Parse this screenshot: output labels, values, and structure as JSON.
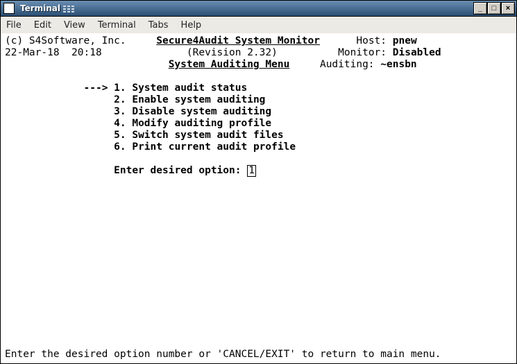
{
  "window": {
    "title": "Terminal"
  },
  "menubar": {
    "items": [
      "File",
      "Edit",
      "View",
      "Terminal",
      "Tabs",
      "Help"
    ]
  },
  "header": {
    "copyright": "(c) S4Software, Inc.",
    "app_title": "Secure4Audit System Monitor",
    "revision_label": "(Revision 2.32)",
    "menu_title": "System Auditing Menu",
    "datetime": "22-Mar-18  20:18",
    "host_label": "Host:",
    "host_value": "pnew",
    "monitor_label": "Monitor:",
    "monitor_value": "Disabled",
    "auditing_label": "Auditing:",
    "auditing_value": "~ensbn"
  },
  "menu": {
    "arrow": "--->",
    "items": [
      {
        "num": "1",
        "label": "System audit status"
      },
      {
        "num": "2",
        "label": "Enable system auditing"
      },
      {
        "num": "3",
        "label": "Disable system auditing"
      },
      {
        "num": "4",
        "label": "Modify auditing profile"
      },
      {
        "num": "5",
        "label": "Switch system audit files"
      },
      {
        "num": "6",
        "label": "Print current audit profile"
      }
    ],
    "prompt": "Enter desired option:",
    "input_value": "1"
  },
  "footer": {
    "hint": "Enter the desired option number or 'CANCEL/EXIT' to return to main menu."
  }
}
